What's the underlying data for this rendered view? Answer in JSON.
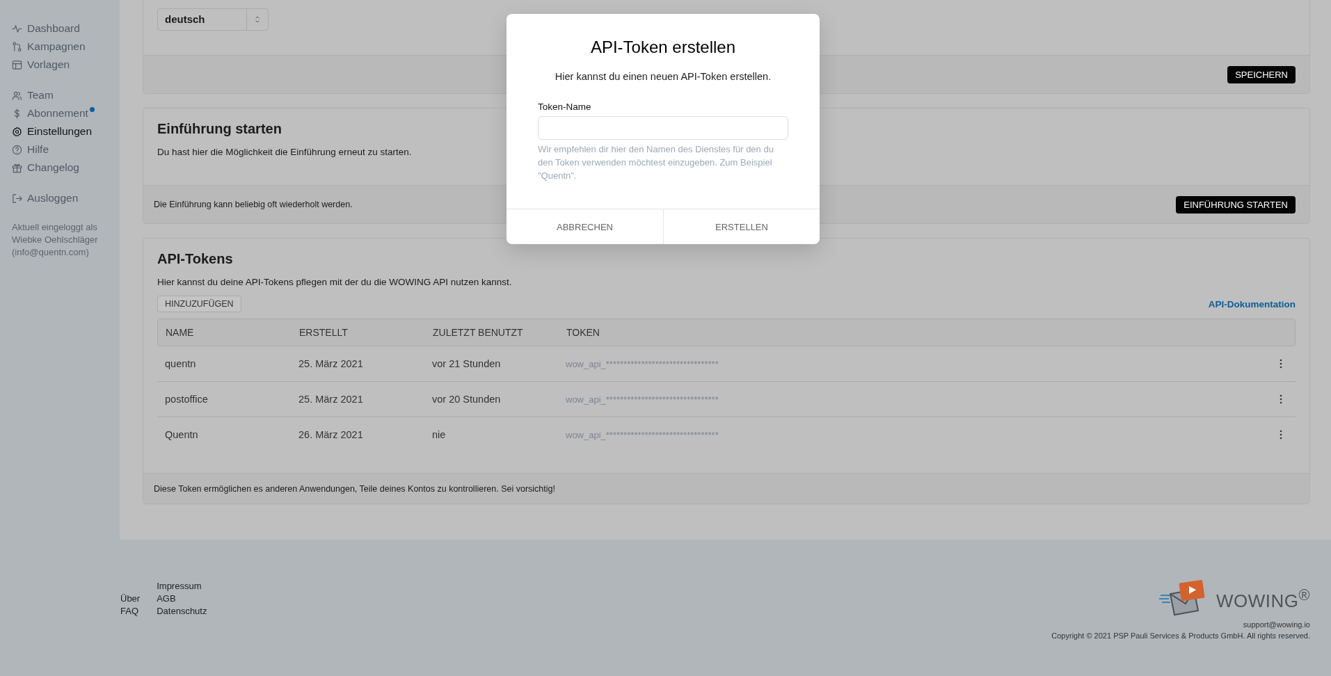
{
  "sidebar": {
    "groups": [
      [
        {
          "label": "Dashboard",
          "selected": false,
          "dot": false
        },
        {
          "label": "Kampagnen",
          "selected": false,
          "dot": false
        },
        {
          "label": "Vorlagen",
          "selected": false,
          "dot": false
        }
      ],
      [
        {
          "label": "Team",
          "selected": false,
          "dot": false
        },
        {
          "label": "Abonnement",
          "selected": false,
          "dot": true
        },
        {
          "label": "Einstellungen",
          "selected": true,
          "dot": false
        },
        {
          "label": "Hilfe",
          "selected": false,
          "dot": false
        },
        {
          "label": "Changelog",
          "selected": false,
          "dot": false
        }
      ],
      [
        {
          "label": "Ausloggen",
          "selected": false,
          "dot": false
        }
      ]
    ],
    "account_lines": [
      "Aktuell eingeloggt als",
      "Wiebke Oehlschläger",
      "(info@quentn.com)"
    ]
  },
  "language": {
    "value": "deutsch",
    "save_button": "SPEICHERN"
  },
  "intro": {
    "title": "Einführung starten",
    "description": "Du hast hier die Möglichkeit die Einführung erneut zu starten.",
    "footer_note": "Die Einführung kann beliebig oft wiederholt werden.",
    "button": "EINFÜHRUNG STARTEN"
  },
  "api_tokens": {
    "title": "API-Tokens",
    "description": "Hier kannst du deine API-Tokens pflegen mit der du die WOWING API nutzen kannst.",
    "add_button": "HINZUZUFÜGEN",
    "doc_link": "API-Dokumentation",
    "table": {
      "columns": [
        "NAME",
        "ERSTELLT",
        "ZULETZT BENUTZT",
        "TOKEN"
      ],
      "rows": [
        {
          "name": "quentn",
          "created": "25. März 2021",
          "last_used": "vor 21 Stunden",
          "token": "wow_api_********************************"
        },
        {
          "name": "postoffice",
          "created": "25. März 2021",
          "last_used": "vor 20 Stunden",
          "token": "wow_api_********************************"
        },
        {
          "name": "Quentn",
          "created": "26. März 2021",
          "last_used": "nie",
          "token": "wow_api_********************************"
        }
      ]
    },
    "footer_note": "Diese Token ermöglichen es anderen Anwendungen, Teile deines Kontos zu kontrollieren. Sei vorsichtig!"
  },
  "modal": {
    "title": "API-Token erstellen",
    "subtitle": "Hier kannst du einen neuen API-Token erstellen.",
    "field_label": "Token-Name",
    "hint": "Wir empfehlen dir hier den Namen des Dienstes für den du den Token verwenden möchtest einzugeben. Zum Beispiel \"Quentn\".",
    "buttons": [
      "ABBRECHEN",
      "ERSTELLEN"
    ]
  },
  "footer": {
    "link_columns": [
      [
        "Über",
        "FAQ"
      ],
      [
        "Impressum",
        "AGB",
        "Datenschutz"
      ]
    ],
    "brand": "WOWING$^{®}$",
    "support_email": "support@wowing.io",
    "copyright": "Copyright © 2021 PSP Pauli Services & Products GmbH. All rights reserved."
  }
}
